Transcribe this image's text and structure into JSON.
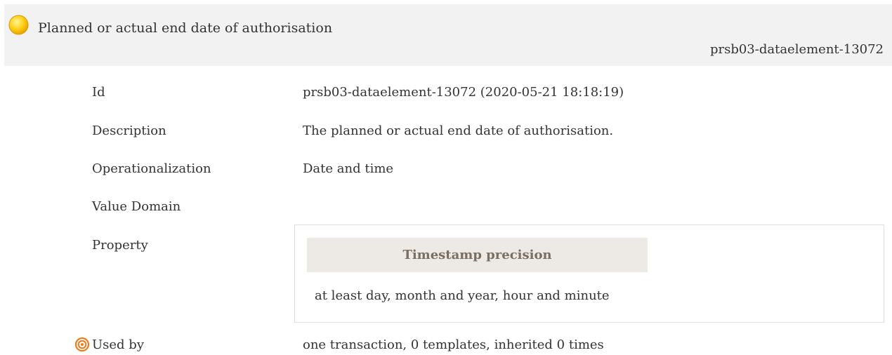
{
  "header": {
    "status_icon": "status-circle-icon",
    "status_color": "#f5c000",
    "title": "Planned or actual end date of authorisation",
    "element_id": "prsb03-dataelement-13072"
  },
  "rows": {
    "id": {
      "label": "Id",
      "value": "prsb03-dataelement-13072 (2020-05-21 18:18:19)"
    },
    "description": {
      "label": "Description",
      "value": "The planned or actual end date of authorisation."
    },
    "operationalization": {
      "label": "Operationalization",
      "value": "Date and time"
    },
    "value_domain": {
      "label": "Value Domain",
      "value": ""
    },
    "property": {
      "label": "Property",
      "header": "Timestamp precision",
      "value": "at least day, month and year, hour and minute"
    },
    "used_by": {
      "label": "Used by",
      "icon": "target-icon",
      "icon_color": "#f07b1b",
      "value": "one transaction, 0 templates, inherited 0 times"
    }
  }
}
